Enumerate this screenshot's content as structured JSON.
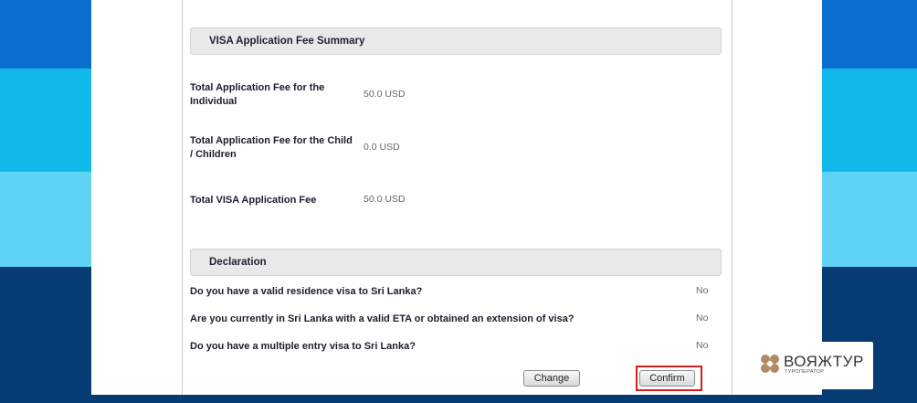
{
  "fee_summary": {
    "header": "VISA Application Fee Summary",
    "rows": [
      {
        "label": "Total Application Fee for the Individual",
        "value": "50.0 USD"
      },
      {
        "label": "Total Application Fee for the Child / Children",
        "value": "0.0 USD"
      },
      {
        "label": "Total VISA Application Fee",
        "value": "50.0 USD"
      }
    ]
  },
  "declaration": {
    "header": "Declaration",
    "questions": [
      {
        "label": "Do you have a valid residence visa to Sri Lanka?",
        "value": "No"
      },
      {
        "label": "Are you currently in Sri Lanka with a valid ETA or obtained an extension of visa?",
        "value": "No"
      },
      {
        "label": "Do you have a multiple entry visa to Sri Lanka?",
        "value": "No"
      }
    ]
  },
  "buttons": {
    "change": "Change",
    "confirm": "Confirm"
  },
  "logo": {
    "name": "ВОЯЖТУР",
    "tagline": "ТУРОПЕРАТОР"
  },
  "colors": {
    "accent_highlight": "#d51d1d",
    "background_bands": [
      "#0a6fce",
      "#11b9ea",
      "#5ed3f6",
      "#063c73"
    ],
    "logo_mark": "#b08a62"
  }
}
